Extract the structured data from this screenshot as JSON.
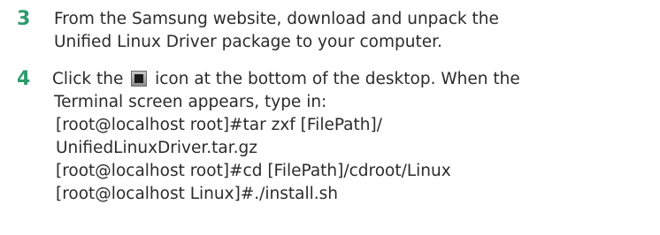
{
  "steps": [
    {
      "number": "3",
      "lines": [
        "From the Samsung website, download and unpack the",
        "Unified Linux Driver package to your computer."
      ]
    },
    {
      "number": "4",
      "line1_before_icon": " Click the ",
      "line1_after_icon": " icon at the bottom of the desktop. When the",
      "line2": "Terminal screen appears, type in:",
      "commands": [
        "[root@localhost root]#tar zxf [FilePath]/",
        "UnifiedLinuxDriver.tar.gz",
        "[root@localhost root]#cd [FilePath]/cdroot/Linux",
        "[root@localhost Linux]#./install.sh"
      ],
      "icon": "terminal-icon"
    }
  ],
  "colors": {
    "step_number": "#2e9b6e",
    "text": "#2b2b2b"
  }
}
